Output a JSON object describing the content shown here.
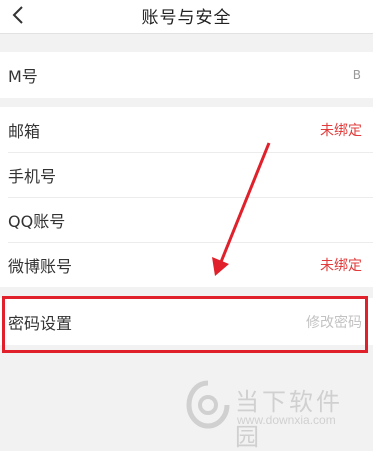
{
  "header": {
    "title": "账号与安全",
    "back_icon": "chevron-left-icon"
  },
  "rows": [
    {
      "label": "M号",
      "value": "B"
    },
    {
      "label": "邮箱",
      "value": "未绑定"
    },
    {
      "label": "手机号",
      "value": ""
    },
    {
      "label": "QQ账号",
      "value": ""
    },
    {
      "label": "微博账号",
      "value": "未绑定"
    },
    {
      "label": "密码设置",
      "value": "修改密码"
    }
  ],
  "watermark": {
    "brand": "当下软件园",
    "url": "www.downxia.com"
  },
  "colors": {
    "unbound_red": "#e23b3b",
    "highlight_red": "#e0202a",
    "background": "#f2f2f2"
  }
}
